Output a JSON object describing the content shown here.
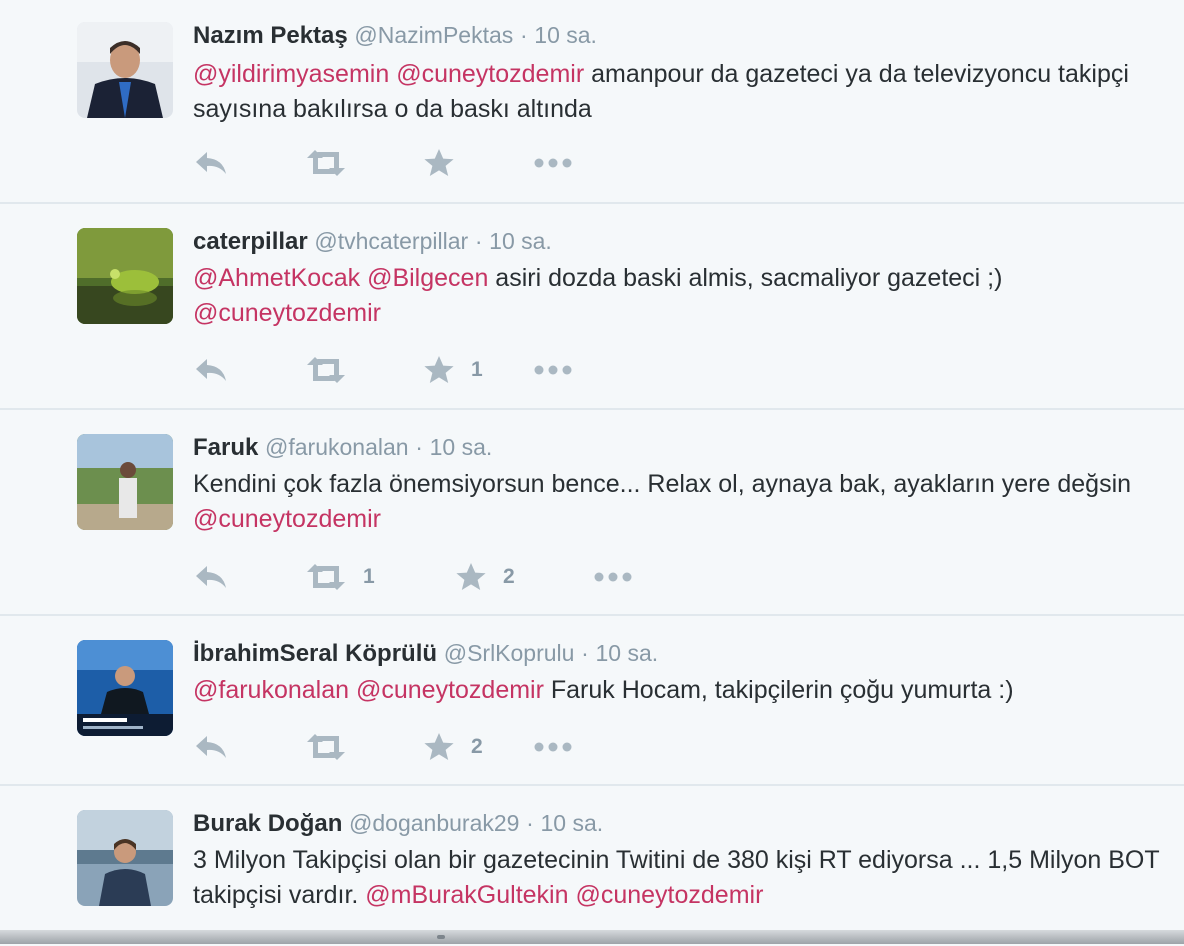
{
  "tweets": [
    {
      "name": "Nazım Pektaş",
      "handle": "@NazimPektas",
      "time": "10 sa.",
      "text_segments": [
        {
          "t": "@yildirimyasemin",
          "m": true
        },
        {
          "t": " ",
          "m": false
        },
        {
          "t": "@cuneytozdemir",
          "m": true
        },
        {
          "t": " amanpour da gazeteci ya da televizyoncu takipçi sayısına bakılırsa o da baskı altında",
          "m": false
        }
      ],
      "retweets": "",
      "likes": ""
    },
    {
      "name": "caterpillar",
      "handle": "@tvhcaterpillar",
      "time": "10 sa.",
      "text_segments": [
        {
          "t": "@AhmetKocak",
          "m": true
        },
        {
          "t": " ",
          "m": false
        },
        {
          "t": "@Bilgecen",
          "m": true
        },
        {
          "t": " asiri dozda baski almis, sacmaliyor gazeteci ;) ",
          "m": false
        },
        {
          "t": "@cuneytozdemir",
          "m": true
        }
      ],
      "retweets": "",
      "likes": "1"
    },
    {
      "name": "Faruk",
      "handle": "@farukonalan",
      "time": "10 sa.",
      "text_segments": [
        {
          "t": "Kendini çok fazla önemsiyorsun bence...  Relax ol, aynaya bak, ayakların yere değsin ",
          "m": false
        },
        {
          "t": "@cuneytozdemir",
          "m": true
        }
      ],
      "retweets": "1",
      "likes": "2"
    },
    {
      "name": "İbrahimSeral Köprülü",
      "handle": "@SrlKoprulu",
      "time": "10 sa.",
      "text_segments": [
        {
          "t": "@farukonalan",
          "m": true
        },
        {
          "t": " ",
          "m": false
        },
        {
          "t": "@cuneytozdemir",
          "m": true
        },
        {
          "t": " Faruk Hocam, takipçilerin çoğu yumurta :)",
          "m": false
        }
      ],
      "retweets": "",
      "likes": "2"
    },
    {
      "name": "Burak Doğan",
      "handle": "@doganburak29",
      "time": "10 sa.",
      "text_segments": [
        {
          "t": "3 Milyon Takipçisi olan bir gazetecinin Twitini de 380 kişi RT ediyorsa ... 1,5 Milyon BOT takipçisi vardır. ",
          "m": false
        },
        {
          "t": "@mBurakGultekin",
          "m": true
        },
        {
          "t": " ",
          "m": false
        },
        {
          "t": "@cuneytozdemir",
          "m": true
        }
      ],
      "retweets": "",
      "likes": ""
    }
  ],
  "separator": "·",
  "icons": {
    "reply": "reply-icon",
    "retweet": "retweet-icon",
    "like": "star-icon",
    "more": "more-icon"
  },
  "colors": {
    "mention": "#c53463",
    "text": "#292f33",
    "muted": "#8899a6",
    "icon": "#aab8c2"
  }
}
